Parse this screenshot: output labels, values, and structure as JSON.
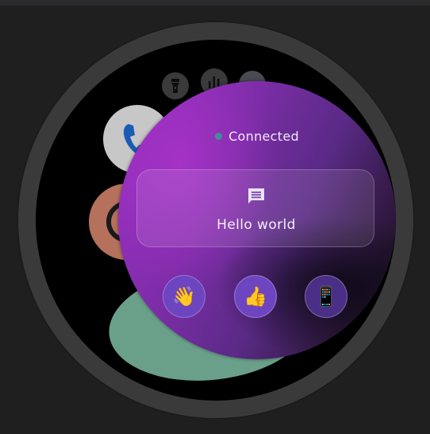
{
  "status": {
    "text": "Connected",
    "dot_color": "#3f8f9b"
  },
  "message": {
    "text": "Hello world",
    "icon": "message-icon"
  },
  "quick_actions": [
    {
      "name": "wave",
      "icon": "👋"
    },
    {
      "name": "thumbs-up",
      "icon": "👍"
    },
    {
      "name": "phone",
      "icon": "📱"
    }
  ],
  "background_apps": [
    {
      "name": "flashlight",
      "icon": "flashlight-icon"
    },
    {
      "name": "chart",
      "icon": "bar-chart-icon"
    },
    {
      "name": "phone",
      "icon": "phone-icon"
    }
  ],
  "colors": {
    "panel_purple": "#9a2fc4",
    "button_purple": "#6d45c0",
    "accent_green": "#6aa08a",
    "accent_rust": "#b5715c"
  }
}
